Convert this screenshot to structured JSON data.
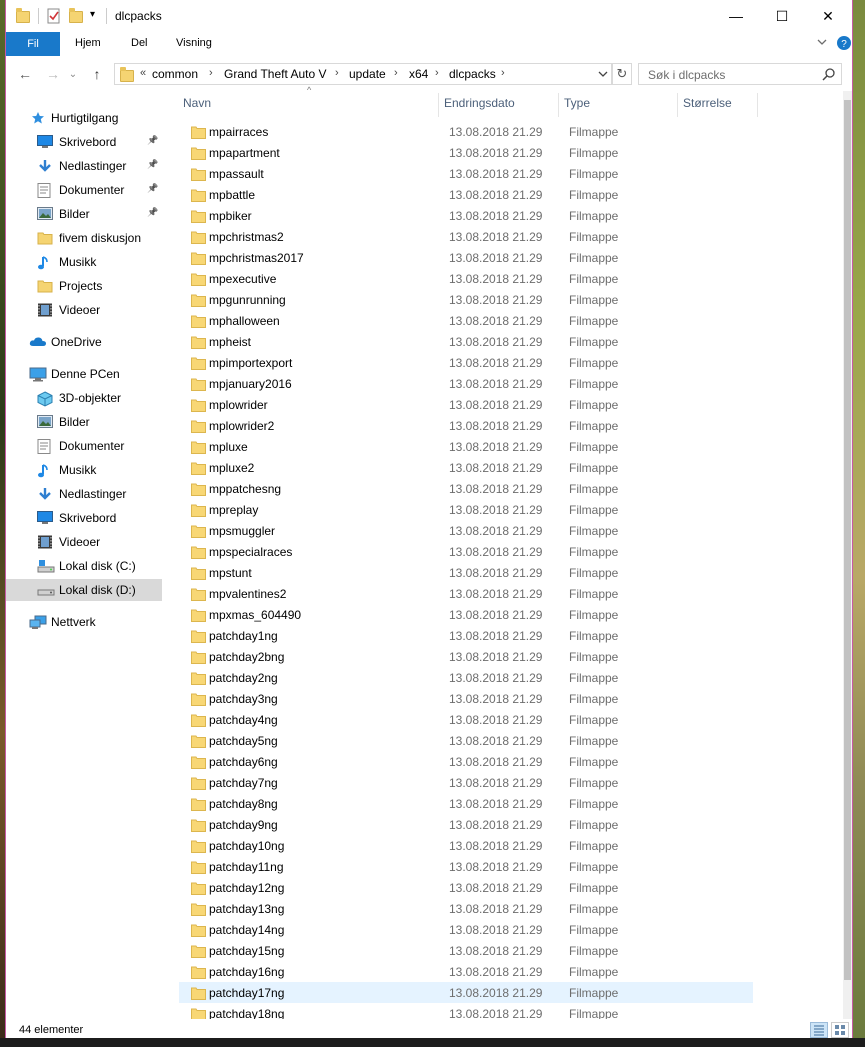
{
  "window": {
    "title": "dlcpacks",
    "minimize": "—",
    "maximize": "☐",
    "close": "✕"
  },
  "ribbon": {
    "file": "Fil",
    "tabs": [
      "Hjem",
      "Del",
      "Visning"
    ],
    "expand_icon": "chevron-down-icon",
    "help_icon": "help-icon"
  },
  "nav": {
    "back_icon": "←",
    "forward_icon": "→",
    "recent_icon": "⌄",
    "up_icon": "↑",
    "overflow": "«",
    "breadcrumbs": [
      "common",
      "Grand Theft Auto V",
      "update",
      "x64",
      "dlcpacks"
    ],
    "search_placeholder": "Søk i dlcpacks",
    "refresh_icon": "↻"
  },
  "sidebar": {
    "quick_access": "Hurtigtilgang",
    "quick_items": [
      {
        "label": "Skrivebord",
        "icon": "desktop-icon",
        "pinned": true
      },
      {
        "label": "Nedlastinger",
        "icon": "download-icon",
        "pinned": true
      },
      {
        "label": "Dokumenter",
        "icon": "documents-icon",
        "pinned": true
      },
      {
        "label": "Bilder",
        "icon": "pictures-icon",
        "pinned": true
      },
      {
        "label": "fivem diskusjon",
        "icon": "folder-icon",
        "pinned": false
      },
      {
        "label": "Musikk",
        "icon": "music-icon",
        "pinned": false
      },
      {
        "label": "Projects",
        "icon": "folder-icon",
        "pinned": false
      },
      {
        "label": "Videoer",
        "icon": "videos-icon",
        "pinned": false
      }
    ],
    "onedrive": "OneDrive",
    "this_pc": "Denne PCen",
    "pc_items": [
      {
        "label": "3D-objekter",
        "icon": "3d-objects-icon"
      },
      {
        "label": "Bilder",
        "icon": "pictures-icon"
      },
      {
        "label": "Dokumenter",
        "icon": "documents-icon"
      },
      {
        "label": "Musikk",
        "icon": "music-icon"
      },
      {
        "label": "Nedlastinger",
        "icon": "download-icon"
      },
      {
        "label": "Skrivebord",
        "icon": "desktop-icon"
      },
      {
        "label": "Videoer",
        "icon": "videos-icon"
      },
      {
        "label": "Lokal disk (C:)",
        "icon": "drive-c-icon"
      },
      {
        "label": "Lokal disk (D:)",
        "icon": "drive-d-icon",
        "selected": true
      }
    ],
    "network": "Nettverk"
  },
  "columns": {
    "name": "Navn",
    "date": "Endringsdato",
    "type": "Type",
    "size": "Størrelse"
  },
  "files": [
    {
      "name": "mpairraces",
      "date": "13.08.2018 21.29",
      "type": "Filmappe"
    },
    {
      "name": "mpapartment",
      "date": "13.08.2018 21.29",
      "type": "Filmappe"
    },
    {
      "name": "mpassault",
      "date": "13.08.2018 21.29",
      "type": "Filmappe"
    },
    {
      "name": "mpbattle",
      "date": "13.08.2018 21.29",
      "type": "Filmappe"
    },
    {
      "name": "mpbiker",
      "date": "13.08.2018 21.29",
      "type": "Filmappe"
    },
    {
      "name": "mpchristmas2",
      "date": "13.08.2018 21.29",
      "type": "Filmappe"
    },
    {
      "name": "mpchristmas2017",
      "date": "13.08.2018 21.29",
      "type": "Filmappe"
    },
    {
      "name": "mpexecutive",
      "date": "13.08.2018 21.29",
      "type": "Filmappe"
    },
    {
      "name": "mpgunrunning",
      "date": "13.08.2018 21.29",
      "type": "Filmappe"
    },
    {
      "name": "mphalloween",
      "date": "13.08.2018 21.29",
      "type": "Filmappe"
    },
    {
      "name": "mpheist",
      "date": "13.08.2018 21.29",
      "type": "Filmappe"
    },
    {
      "name": "mpimportexport",
      "date": "13.08.2018 21.29",
      "type": "Filmappe"
    },
    {
      "name": "mpjanuary2016",
      "date": "13.08.2018 21.29",
      "type": "Filmappe"
    },
    {
      "name": "mplowrider",
      "date": "13.08.2018 21.29",
      "type": "Filmappe"
    },
    {
      "name": "mplowrider2",
      "date": "13.08.2018 21.29",
      "type": "Filmappe"
    },
    {
      "name": "mpluxe",
      "date": "13.08.2018 21.29",
      "type": "Filmappe"
    },
    {
      "name": "mpluxe2",
      "date": "13.08.2018 21.29",
      "type": "Filmappe"
    },
    {
      "name": "mppatchesng",
      "date": "13.08.2018 21.29",
      "type": "Filmappe"
    },
    {
      "name": "mpreplay",
      "date": "13.08.2018 21.29",
      "type": "Filmappe"
    },
    {
      "name": "mpsmuggler",
      "date": "13.08.2018 21.29",
      "type": "Filmappe"
    },
    {
      "name": "mpspecialraces",
      "date": "13.08.2018 21.29",
      "type": "Filmappe"
    },
    {
      "name": "mpstunt",
      "date": "13.08.2018 21.29",
      "type": "Filmappe"
    },
    {
      "name": "mpvalentines2",
      "date": "13.08.2018 21.29",
      "type": "Filmappe"
    },
    {
      "name": "mpxmas_604490",
      "date": "13.08.2018 21.29",
      "type": "Filmappe"
    },
    {
      "name": "patchday1ng",
      "date": "13.08.2018 21.29",
      "type": "Filmappe"
    },
    {
      "name": "patchday2bng",
      "date": "13.08.2018 21.29",
      "type": "Filmappe"
    },
    {
      "name": "patchday2ng",
      "date": "13.08.2018 21.29",
      "type": "Filmappe"
    },
    {
      "name": "patchday3ng",
      "date": "13.08.2018 21.29",
      "type": "Filmappe"
    },
    {
      "name": "patchday4ng",
      "date": "13.08.2018 21.29",
      "type": "Filmappe"
    },
    {
      "name": "patchday5ng",
      "date": "13.08.2018 21.29",
      "type": "Filmappe"
    },
    {
      "name": "patchday6ng",
      "date": "13.08.2018 21.29",
      "type": "Filmappe"
    },
    {
      "name": "patchday7ng",
      "date": "13.08.2018 21.29",
      "type": "Filmappe"
    },
    {
      "name": "patchday8ng",
      "date": "13.08.2018 21.29",
      "type": "Filmappe"
    },
    {
      "name": "patchday9ng",
      "date": "13.08.2018 21.29",
      "type": "Filmappe"
    },
    {
      "name": "patchday10ng",
      "date": "13.08.2018 21.29",
      "type": "Filmappe"
    },
    {
      "name": "patchday11ng",
      "date": "13.08.2018 21.29",
      "type": "Filmappe"
    },
    {
      "name": "patchday12ng",
      "date": "13.08.2018 21.29",
      "type": "Filmappe"
    },
    {
      "name": "patchday13ng",
      "date": "13.08.2018 21.29",
      "type": "Filmappe"
    },
    {
      "name": "patchday14ng",
      "date": "13.08.2018 21.29",
      "type": "Filmappe"
    },
    {
      "name": "patchday15ng",
      "date": "13.08.2018 21.29",
      "type": "Filmappe"
    },
    {
      "name": "patchday16ng",
      "date": "13.08.2018 21.29",
      "type": "Filmappe"
    },
    {
      "name": "patchday17ng",
      "date": "13.08.2018 21.29",
      "type": "Filmappe",
      "hover": true
    },
    {
      "name": "patchday18ng",
      "date": "13.08.2018 21.29",
      "type": "Filmappe"
    }
  ],
  "status": {
    "count": "44 elementer"
  }
}
